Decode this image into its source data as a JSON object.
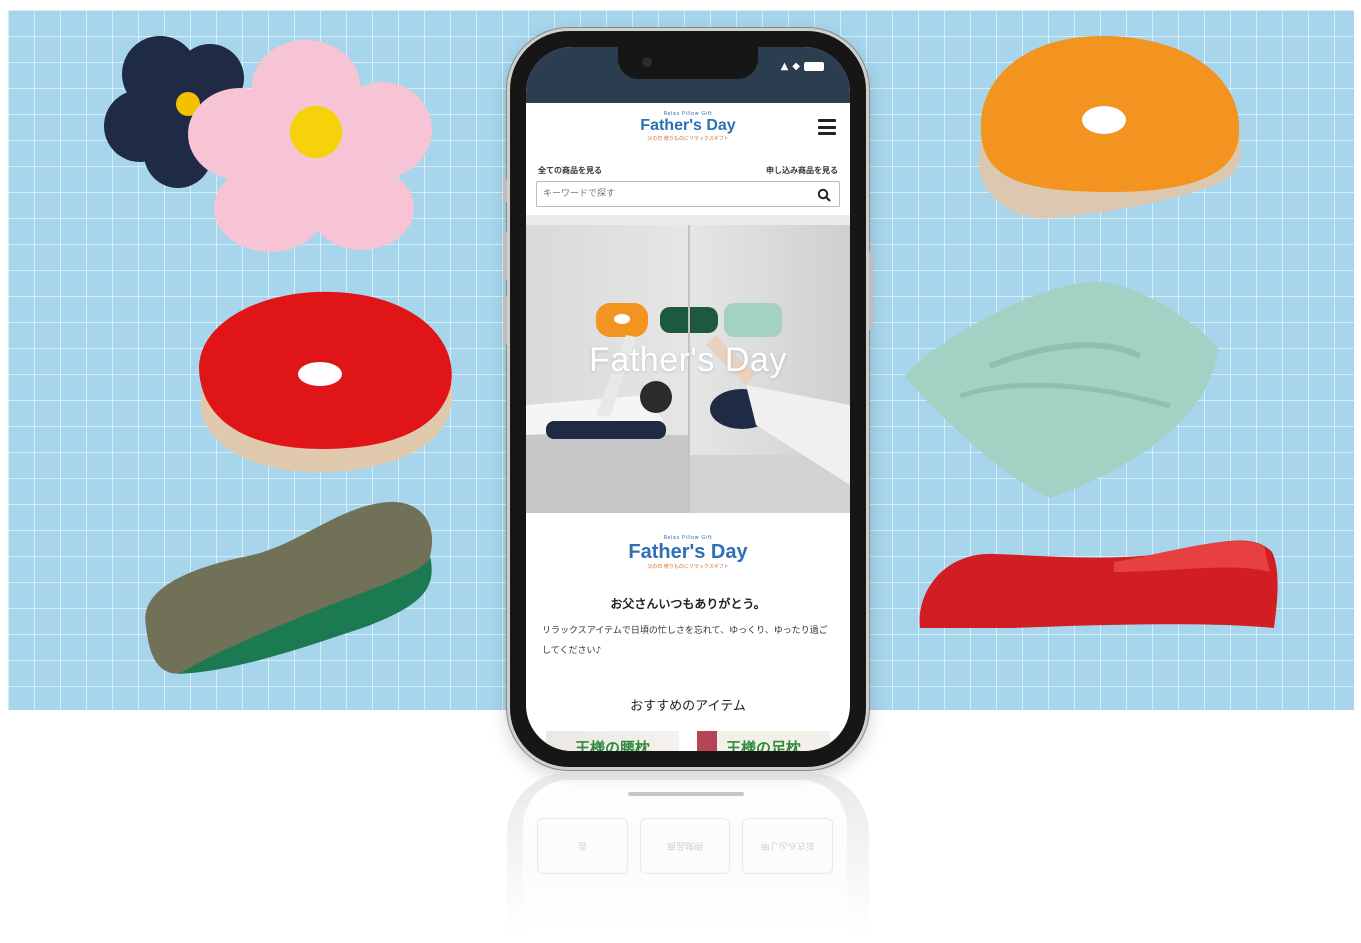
{
  "phone": {
    "header": {
      "logo_small": "Relax Pillow Gift",
      "logo_main": "Father's Day",
      "logo_sub": "父の日 贈りものにリラックスギフト"
    },
    "nav": {
      "all_products": "全ての商品を見る",
      "preorder_products": "申し込み商品を見る"
    },
    "search": {
      "placeholder": "キーワードで探す"
    },
    "hero": {
      "title": "Father's Day"
    },
    "section": {
      "logo_small": "Relax Pillow Gift",
      "logo_main": "Father's Day",
      "logo_sub": "父の日 贈りものにリラックスギフト",
      "tagline": "お父さんいつもありがとう。",
      "body": "リラックスアイテムで日頃の忙しさを忘れて、ゆっくり、ゆったり過ごしてください♪",
      "recommend_title": "おすすめのアイテム",
      "products": [
        {
          "label": "王様の腰枕"
        },
        {
          "label": "王様の足枕"
        }
      ]
    },
    "reflection": {
      "buttons": [
        "会",
        "商品説明",
        "申し込み方法"
      ]
    }
  },
  "colors": {
    "background_grid": "#a7d6ec",
    "brand_blue": "#2d6fb6",
    "product_green": "#2f8a3c",
    "status_bar": "#2b3d4f"
  }
}
